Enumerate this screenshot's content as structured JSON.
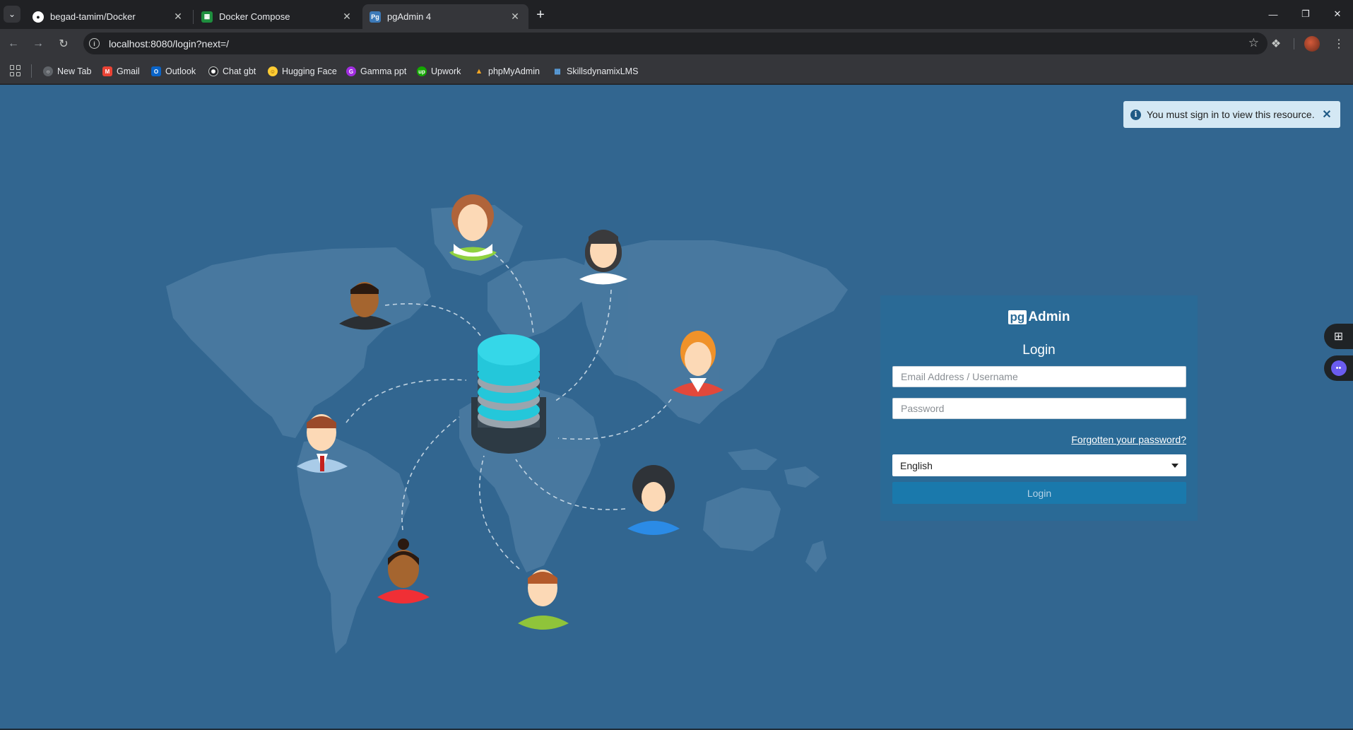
{
  "tabs": [
    {
      "title": "begad-tamim/Docker",
      "favicon": "github-icon",
      "active": false
    },
    {
      "title": "Docker Compose",
      "favicon": "google-sheets-icon",
      "active": false
    },
    {
      "title": "pgAdmin 4",
      "favicon": "pgadmin-icon",
      "favicon_text": "Pg",
      "active": true
    }
  ],
  "address_bar": {
    "url": "localhost:8080/login?next=/"
  },
  "bookmarks": [
    {
      "label": "New Tab",
      "icon": "globe-icon"
    },
    {
      "label": "Gmail",
      "icon": "gmail-icon"
    },
    {
      "label": "Outlook",
      "icon": "outlook-icon"
    },
    {
      "label": "Chat gbt",
      "icon": "openai-icon"
    },
    {
      "label": "Hugging Face",
      "icon": "hugging-face-icon"
    },
    {
      "label": "Gamma ppt",
      "icon": "gamma-icon"
    },
    {
      "label": "Upwork",
      "icon": "upwork-icon"
    },
    {
      "label": "phpMyAdmin",
      "icon": "phpmyadmin-icon"
    },
    {
      "label": "SkillsdynamixLMS",
      "icon": "lms-icon"
    }
  ],
  "toast": {
    "message": "You must sign in to view this resource.",
    "icon": "info-icon"
  },
  "login": {
    "logo_pg": "pg",
    "logo_rest": "Admin",
    "title": "Login",
    "email_placeholder": "Email Address / Username",
    "password_placeholder": "Password",
    "forgot_link": "Forgotten your password?",
    "language": "English",
    "submit_label": "Login"
  },
  "colors": {
    "page_background": "#326690",
    "panel_background": "#2a6a96",
    "login_button": "#1a79ac",
    "toast_background": "#d4e8f4"
  }
}
